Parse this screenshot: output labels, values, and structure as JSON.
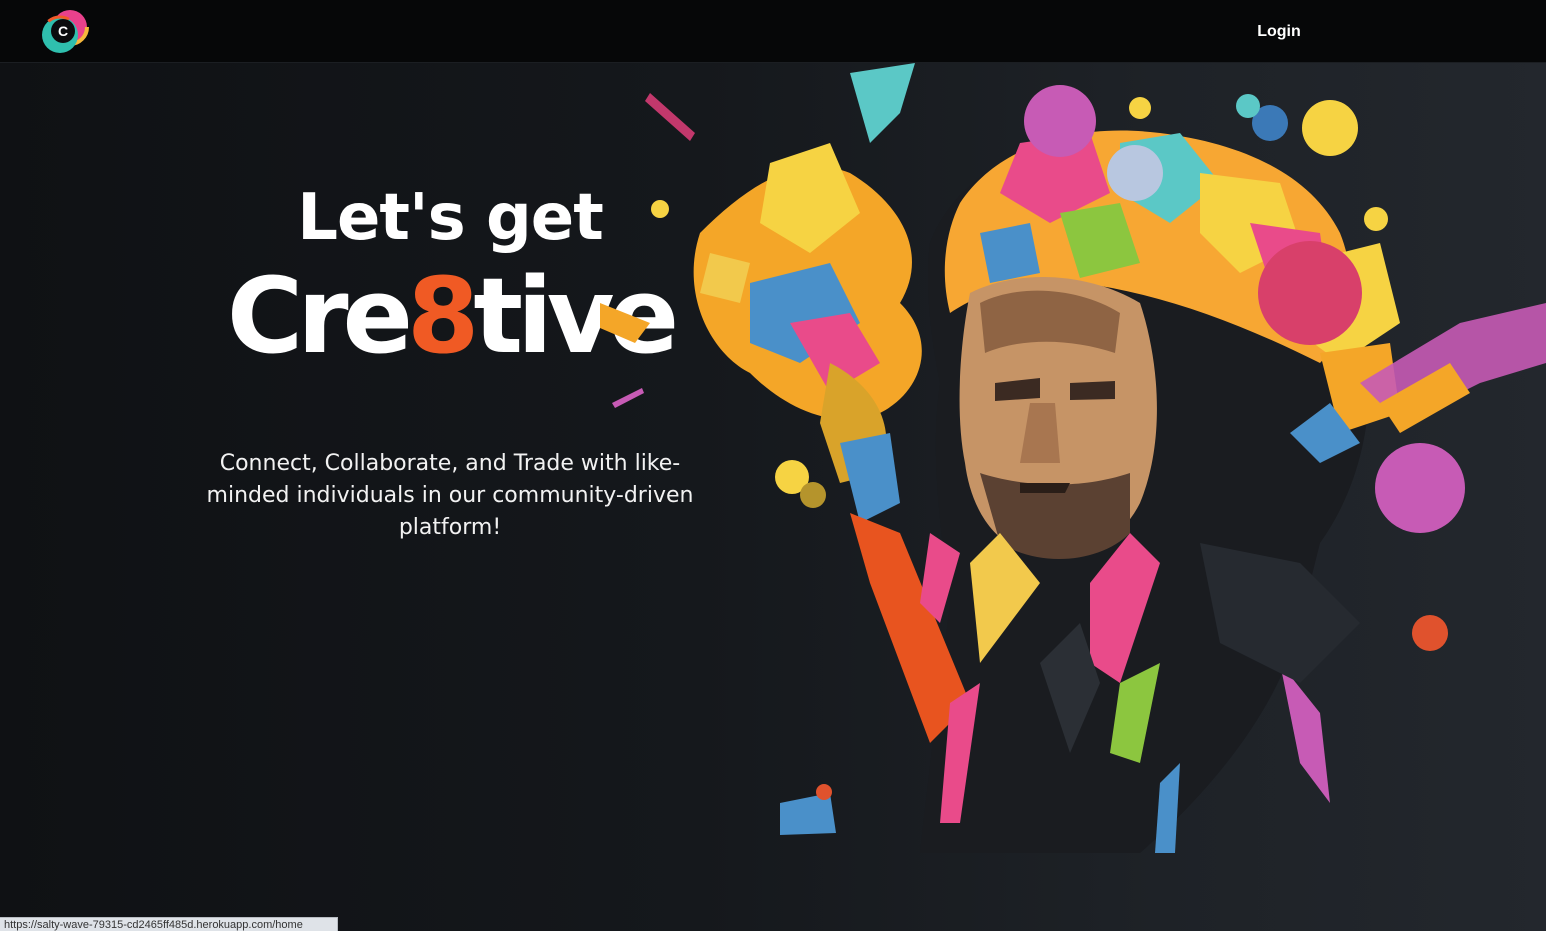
{
  "nav": {
    "logo_letter": "C",
    "login_label": "Login"
  },
  "hero": {
    "headline_line1": "Let's get",
    "headline_prefix": "Cre",
    "headline_accent": "8",
    "headline_suffix": "tive",
    "tagline": "Connect, Collaborate, and Trade with like-minded individuals in our community-driven platform!",
    "illustration": "colorful-paint-splash-hooded-man"
  },
  "status_bar": {
    "url": "https://salty-wave-79315-cd2465ff485d.herokuapp.com/home"
  },
  "colors": {
    "accent": "#f05a24",
    "background_dark": "#0f1114",
    "navbar": "#060708",
    "text": "#ffffff"
  }
}
